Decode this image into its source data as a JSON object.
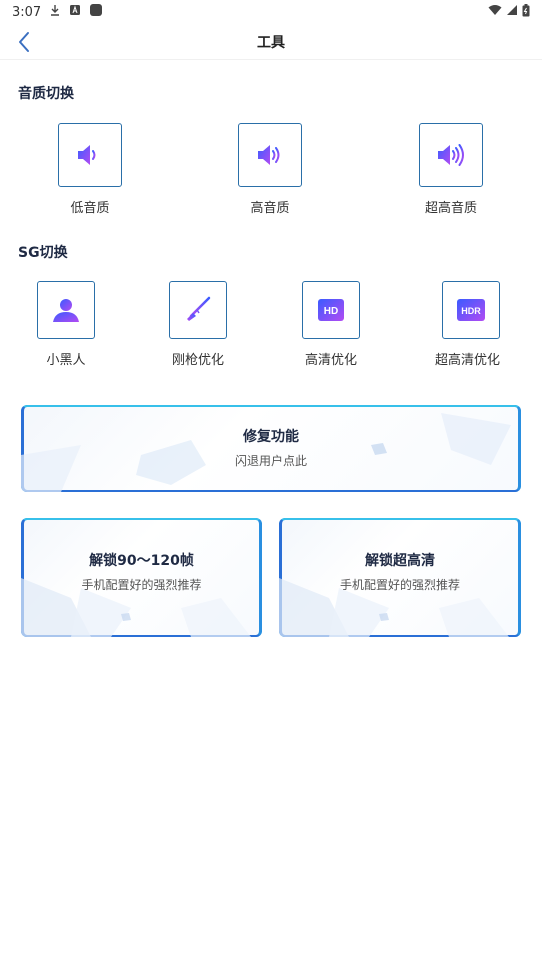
{
  "status_bar": {
    "time": "3:07"
  },
  "header": {
    "title": "工具"
  },
  "sound_section": {
    "title": "音质切换",
    "items": [
      {
        "label": "低音质",
        "icon": "speaker-low-icon"
      },
      {
        "label": "高音质",
        "icon": "speaker-medium-icon"
      },
      {
        "label": "超高音质",
        "icon": "speaker-high-icon"
      }
    ]
  },
  "sg_section": {
    "title": "SG切换",
    "items": [
      {
        "label": "小黑人",
        "icon": "person-icon"
      },
      {
        "label": "刚枪优化",
        "icon": "rifle-icon"
      },
      {
        "label": "高清优化",
        "icon": "hd-icon",
        "badge": "HD"
      },
      {
        "label": "超高清优化",
        "icon": "hdr-icon",
        "badge": "HDR"
      }
    ]
  },
  "repair_card": {
    "title": "修复功能",
    "subtitle": "闪退用户点此"
  },
  "fps_card": {
    "title": "解锁90～120帧",
    "subtitle": "手机配置好的强烈推荐"
  },
  "uhd_card": {
    "title": "解锁超高清",
    "subtitle": "手机配置好的强烈推荐"
  },
  "colors": {
    "accent": "#2a6fd6",
    "border": "#2a6fa8",
    "icon_gradient_start": "#3a5bff",
    "icon_gradient_end": "#b24bf3"
  }
}
